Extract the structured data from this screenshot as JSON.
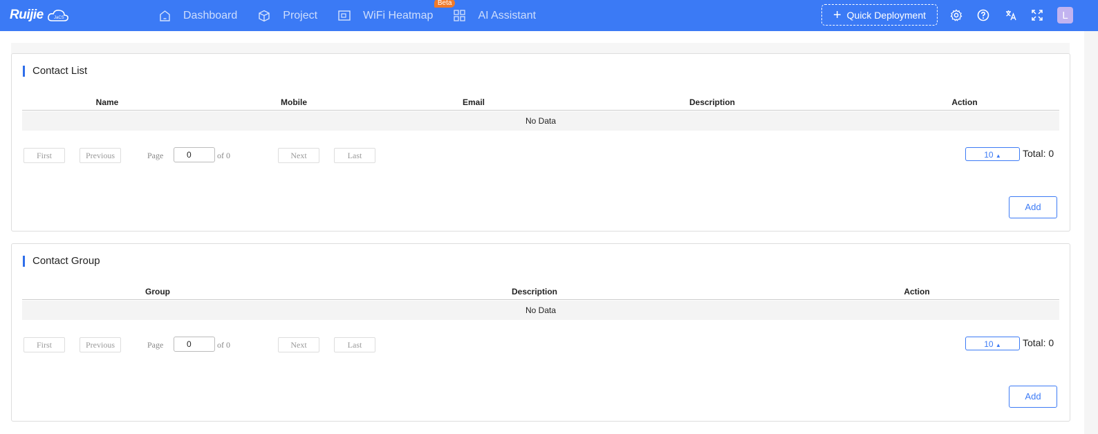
{
  "brand": {
    "logo_text": "Ruijie",
    "logo_sub": "JaCS"
  },
  "nav": {
    "items": [
      {
        "label": "Dashboard",
        "icon": "home-icon"
      },
      {
        "label": "Project",
        "icon": "cube-icon"
      },
      {
        "label": "WiFi Heatmap",
        "icon": "heatmap-icon",
        "badge": "Beta"
      },
      {
        "label": "AI Assistant",
        "icon": "grid-icon"
      }
    ]
  },
  "header": {
    "quick_deployment": "Quick Deployment",
    "avatar_letter": "L"
  },
  "contact_list": {
    "title": "Contact List",
    "columns": [
      "Name",
      "Mobile",
      "Email",
      "Description",
      "Action"
    ],
    "no_data": "No Data",
    "pagination": {
      "first": "First",
      "previous": "Previous",
      "page_label": "Page",
      "page_value": "0",
      "of_label": "of 0",
      "next": "Next",
      "last": "Last",
      "page_size": "10",
      "total": "Total: 0"
    },
    "add_label": "Add"
  },
  "contact_group": {
    "title": "Contact Group",
    "columns": [
      "Group",
      "Description",
      "Action"
    ],
    "no_data": "No Data",
    "pagination": {
      "first": "First",
      "previous": "Previous",
      "page_label": "Page",
      "page_value": "0",
      "of_label": "of 0",
      "next": "Next",
      "last": "Last",
      "page_size": "10",
      "total": "Total: 0"
    },
    "add_label": "Add"
  },
  "colors": {
    "primary": "#3b7af5",
    "beta_badge": "#f07a2a",
    "avatar": "#c2b3f0"
  }
}
